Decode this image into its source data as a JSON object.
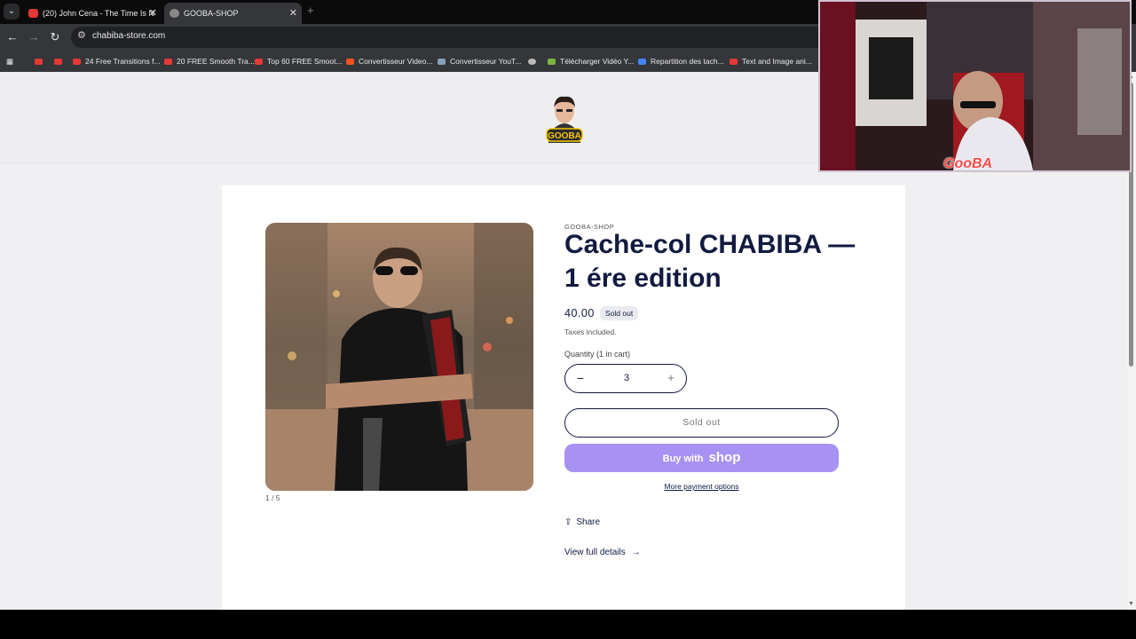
{
  "browser": {
    "tabs": [
      {
        "title": "(20) John Cena - The Time Is N",
        "active": false,
        "favicon": "youtube-icon"
      },
      {
        "title": "GOOBA-SHOP",
        "active": true,
        "favicon": "globe-icon"
      }
    ],
    "url": "chabiba-store.com",
    "bookmarks": [
      {
        "label": "",
        "icon": "youtube-icon"
      },
      {
        "label": "",
        "icon": "youtube-icon"
      },
      {
        "label": "24 Free Transitions f...",
        "icon": "youtube-icon"
      },
      {
        "label": "20 FREE Smooth Tra...",
        "icon": "youtube-icon"
      },
      {
        "label": "Top 60 FREE Smoot...",
        "icon": "youtube-icon"
      },
      {
        "label": "Convertisseur Video...",
        "icon": "z-icon"
      },
      {
        "label": "Convertisseur YouT...",
        "icon": "converter-icon"
      },
      {
        "label": "",
        "icon": "globe-icon"
      },
      {
        "label": "Télécharger Vidéo Y...",
        "icon": "download-icon"
      },
      {
        "label": "Repartition des tach...",
        "icon": "docs-icon"
      },
      {
        "label": "Text and Image ani...",
        "icon": "youtube-icon"
      }
    ]
  },
  "store": {
    "logo_text": "GOOBA"
  },
  "product": {
    "vendor": "GOOBA-SHOP",
    "title": "Cache-col CHABIBA — 1 ére edition",
    "price": "40.00",
    "badge": "Sold out",
    "taxes": "Taxes included.",
    "quantity_label": "Quantity (1 in cart)",
    "quantity_value": "3",
    "minus": "−",
    "plus": "+",
    "sold_out_button": "Sold out",
    "buy_with": "Buy with",
    "shop_word": "shop",
    "more_payment": "More payment options",
    "share": "Share",
    "view_details": "View full details",
    "media_counter": "1 / 5"
  },
  "overlay": {
    "webcam_badge": "GooBA"
  },
  "colors": {
    "accent": "#121a40",
    "shop_pay": "#a792f4",
    "page_bg": "#f0f0f3"
  }
}
